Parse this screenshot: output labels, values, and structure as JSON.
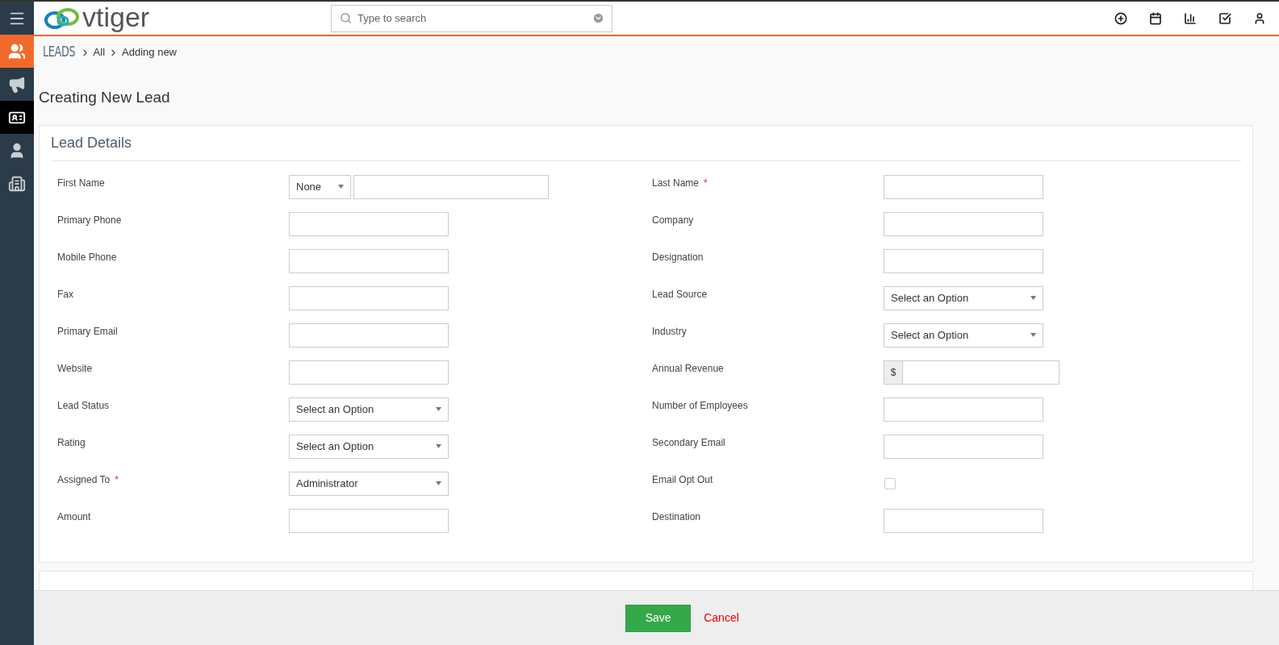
{
  "sidebar": {
    "items": [
      {
        "kind": "menu",
        "selected": false,
        "highlighted": false
      },
      {
        "kind": "leads",
        "selected": true,
        "highlighted": false
      },
      {
        "kind": "campaigns",
        "selected": false,
        "highlighted": false
      },
      {
        "kind": "contacts",
        "selected": false,
        "highlighted": true
      },
      {
        "kind": "person",
        "selected": false,
        "highlighted": false
      },
      {
        "kind": "organizations",
        "selected": false,
        "highlighted": false
      }
    ]
  },
  "header": {
    "logo": "vtiger",
    "search": {
      "placeholder": "Type to search"
    },
    "actions": [
      {
        "kind": "add"
      },
      {
        "kind": "calendar"
      },
      {
        "kind": "reports"
      },
      {
        "kind": "tasks"
      },
      {
        "kind": "user"
      }
    ]
  },
  "breadcrumb": {
    "module": "LEADS",
    "items": [
      "All",
      "Adding new"
    ]
  },
  "page_title": "Creating New Lead",
  "sections": [
    {
      "title": "Lead Details",
      "fields": [
        {
          "label": "First Name",
          "kind": "salutation",
          "salutation": "None"
        },
        {
          "label": "Last Name",
          "required_mark": "*",
          "kind": "text"
        },
        {
          "label": "Primary Phone",
          "kind": "text"
        },
        {
          "label": "Company",
          "kind": "text"
        },
        {
          "label": "Mobile Phone",
          "kind": "text"
        },
        {
          "label": "Designation",
          "kind": "text"
        },
        {
          "label": "Fax",
          "kind": "text"
        },
        {
          "label": "Lead Source",
          "kind": "select",
          "value": "Select an Option"
        },
        {
          "label": "Primary Email",
          "kind": "text"
        },
        {
          "label": "Industry",
          "kind": "select",
          "value": "Select an Option"
        },
        {
          "label": "Website",
          "kind": "text"
        },
        {
          "label": "Annual Revenue",
          "kind": "currency",
          "symbol": "$"
        },
        {
          "label": "Lead Status",
          "kind": "select",
          "value": "Select an Option"
        },
        {
          "label": "Number of Employees",
          "kind": "text"
        },
        {
          "label": "Rating",
          "kind": "select",
          "value": "Select an Option"
        },
        {
          "label": "Secondary Email",
          "kind": "text"
        },
        {
          "label": "Assigned To",
          "required_mark": "*",
          "kind": "select",
          "value": "Administrator"
        },
        {
          "label": "Email Opt Out",
          "kind": "checkbox",
          "checked": false
        },
        {
          "label": "Amount",
          "kind": "text"
        },
        {
          "label": "Destination",
          "kind": "text"
        }
      ]
    }
  ],
  "footer": {
    "save": "Save",
    "cancel": "Cancel"
  }
}
